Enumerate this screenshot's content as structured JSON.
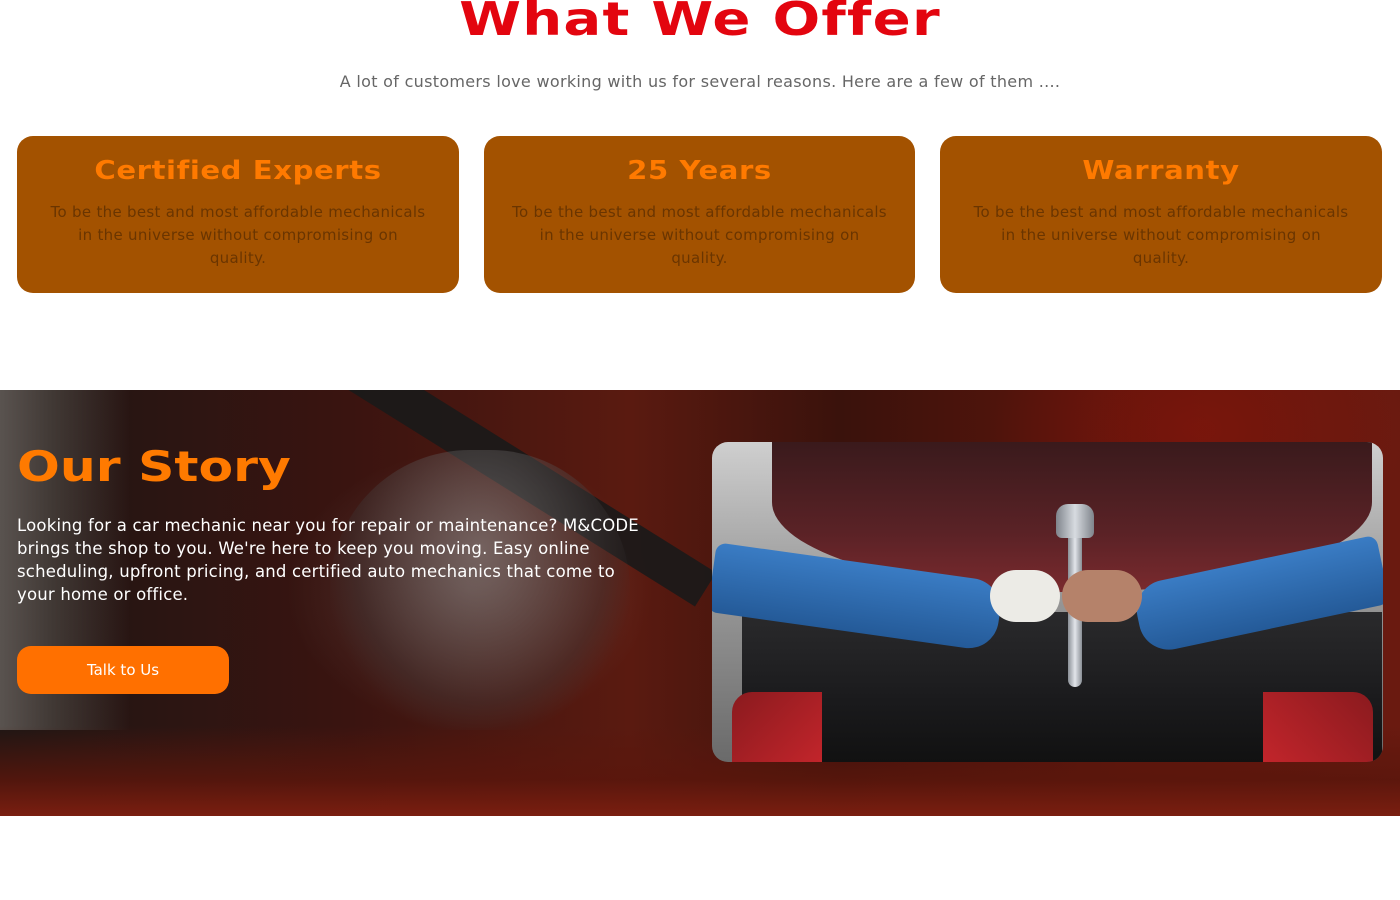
{
  "offer": {
    "title": "What We Offer",
    "subtitle": "A lot of customers love working with us for several reasons. Here are a few of them ....",
    "cards": [
      {
        "title": "Certified Experts",
        "text": "To be the best and most affordable mechanicals in the universe without compromising on quality."
      },
      {
        "title": "25 Years",
        "text": "To be the best and most affordable mechanicals in the universe without compromising on quality."
      },
      {
        "title": "Warranty",
        "text": "To be the best and most affordable mechanicals in the universe without compromising on quality."
      }
    ]
  },
  "story": {
    "title": "Our Story",
    "text": "Looking for a car mechanic near you for repair or maintenance? M&CODE brings the shop to you. We're here to keep you moving. Easy online scheduling, upfront pricing, and certified auto mechanics that come to your home or office.",
    "button_label": "Talk to Us"
  },
  "colors": {
    "offer_title": "#e3050f",
    "card_background": "#a35200",
    "card_title": "#ff7a00",
    "accent_orange": "#ff7000"
  }
}
